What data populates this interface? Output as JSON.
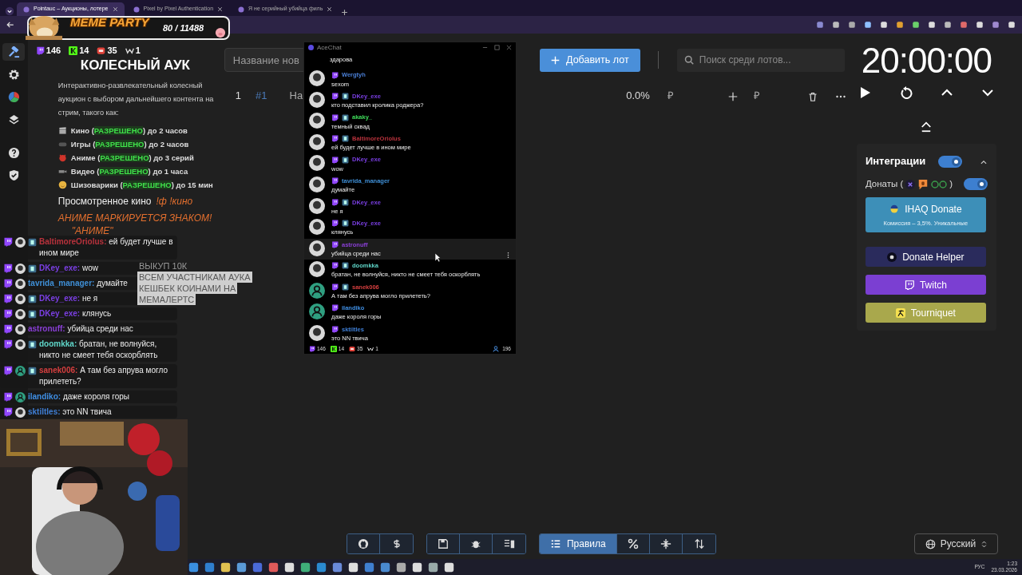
{
  "browser": {
    "tabs": [
      {
        "title": "Pointauc – Аукционы, лотере",
        "selected": true
      },
      {
        "title": "Pixel by Pixel Authentication",
        "selected": false
      },
      {
        "title": "Я не серийный убийца филь",
        "selected": false
      }
    ]
  },
  "meme_party": {
    "title": "MEME PARTY",
    "count": "80 / 11488"
  },
  "sidebar": {
    "items": [
      {
        "selected": true
      },
      {
        "selected": false
      },
      {
        "selected": false
      },
      {
        "selected": false
      },
      {
        "selected": false
      },
      {
        "selected": false
      }
    ]
  },
  "stats": [
    {
      "kind": "twitch",
      "value": "146"
    },
    {
      "kind": "kick",
      "value": "14"
    },
    {
      "kind": "live",
      "value": "35"
    },
    {
      "kind": "w",
      "value": "1"
    }
  ],
  "info": {
    "title": "КОЛЕСНЫЙ АУК",
    "description": "Интерактивно-развлекательный колесный аукцион с выбором дальнейшего контента на стрим, такого как:",
    "categories": [
      {
        "kind": "movie",
        "label": "Кино (",
        "status": "РАЗРЕШЕНО",
        "suffix": ") до 2 часов"
      },
      {
        "kind": "game",
        "label": "Игры (",
        "status": "РАЗРЕШЕНО",
        "suffix": ") до 2 часов"
      },
      {
        "kind": "anime",
        "label": "Аниме (",
        "status": "РАЗРЕШЕНО",
        "suffix": ") до 3 серий"
      },
      {
        "kind": "video",
        "label": "Видео (",
        "status": "РАЗРЕШЕНО",
        "suffix": ") до 1 часа"
      },
      {
        "kind": "meme",
        "label": "Шизоварики (",
        "status": "РАЗРЕШЕНО",
        "suffix": ") до 15 мин"
      }
    ],
    "watched": {
      "label": "Просмотренное кино",
      "commands": "!ф !кино"
    },
    "notes": [
      "АНИМЕ МАРКИРУЕТСЯ ЗНАКОМ!",
      "\"АНИМЕ\""
    ]
  },
  "side_chat": [
    {
      "user": "BaltimoreOriolus:",
      "color": "#b8323c",
      "text": "ей будет лучше в ином мире",
      "badge": true
    },
    {
      "user": "DKey_exe:",
      "color": "#7b3fe4",
      "text": "wow",
      "badge": true
    },
    {
      "user": "tavrida_manager:",
      "color": "#3f8fd6",
      "text": "думайте",
      "badge": false
    },
    {
      "user": "DKey_exe:",
      "color": "#7b3fe4",
      "text": "не я",
      "badge": true
    },
    {
      "user": "DKey_exe:",
      "color": "#7b3fe4",
      "text": "клянусь",
      "badge": true
    },
    {
      "user": "astronuff:",
      "color": "#8a3fd6",
      "text": "убийца среди нас",
      "badge": false
    },
    {
      "user": "doomkka:",
      "color": "#5fd6c9",
      "text": "братан, не волнуйся, никто не смеет тебя оскорблять",
      "badge": true
    },
    {
      "user": "sanek006:",
      "color": "#d63f3f",
      "text": "А там без апрува могло прилететь?",
      "kind": "person",
      "badge": true
    },
    {
      "user": "ilandiko:",
      "color": "#3f8fe4",
      "text": "даже короля горы",
      "kind": "person",
      "badge": false
    },
    {
      "user": "sktiltles:",
      "color": "#3f7fd6",
      "text": "это NN твича",
      "badge": false
    }
  ],
  "announcement": [
    "ВЫКУП 10К",
    "ВСЕМ УЧАСТНИКАМ АУКА",
    "КЕШБЕК КОИНАМИ НА",
    "МЕМАЛЕРТС"
  ],
  "lot_form": {
    "placeholder": "Название нов",
    "button": "Добавить лот",
    "search_placeholder": "Поиск среди лотов..."
  },
  "lots": [
    {
      "index": "1",
      "id": "#1",
      "name": "На",
      "percent": "0.0%",
      "currency": "₽",
      "amount_currency": "₽"
    }
  ],
  "timer": "20:00:00",
  "integrations": {
    "title": "Интеграции",
    "on": true,
    "expanded": true,
    "donations": {
      "label": "Донаты (",
      "suffix": ")",
      "on": true
    },
    "services": [
      {
        "kind": "ihaq",
        "name": "IHAQ Donate",
        "note": "Комиссия – 3,5%. Уникальные",
        "color": "#3d8fb8"
      },
      {
        "kind": "helper",
        "name": "Donate Helper",
        "color": "#2a2b5c"
      },
      {
        "kind": "twitch",
        "name": "Twitch",
        "color": "#7b3fd2"
      },
      {
        "kind": "tourniquet",
        "name": "Tourniquet",
        "color": "#a9a84c"
      }
    ]
  },
  "toolbar": {
    "rules": "Правила"
  },
  "language": "Русский",
  "acechat": {
    "title": "AceChat",
    "messages": [
      {
        "kind": "continuation",
        "text": "здарова",
        "hovered": false
      },
      {
        "user": "Wergtyh",
        "color": "#4a7fd6",
        "text": "sexom",
        "badge": false,
        "hovered": false
      },
      {
        "user": "DKey_exe",
        "color": "#7b3fe4",
        "text": "кто подставил кролика роджера?",
        "badge": true,
        "hovered": false
      },
      {
        "user": "akaky_",
        "color": "#3fdc5a",
        "text": "темный сквад",
        "badge": true,
        "hovered": false
      },
      {
        "user": "BaltimoreOriolus",
        "color": "#b8323c",
        "text": "ей будет лучше в ином мире",
        "badge": true,
        "hovered": false
      },
      {
        "user": "DKey_exe",
        "color": "#7b3fe4",
        "text": "wow",
        "badge": true,
        "hovered": false
      },
      {
        "user": "tavrida_manager",
        "color": "#3f8fd6",
        "text": "думайте",
        "badge": false,
        "hovered": false
      },
      {
        "user": "DKey_exe",
        "color": "#7b3fe4",
        "text": "не я",
        "badge": true,
        "hovered": false
      },
      {
        "user": "DKey_exe",
        "color": "#7b3fe4",
        "text": "клянусь",
        "badge": true,
        "hovered": false
      },
      {
        "user": "astronuff",
        "color": "#8a3fd6",
        "text": "убийца среди нас",
        "badge": false,
        "hovered": true
      },
      {
        "user": "doomkka",
        "color": "#5fd6c9",
        "text": "братан, не волнуйся, никто не смеет тебя оскорблять",
        "badge": true,
        "hovered": false
      },
      {
        "kind": "person",
        "user": "sanek006",
        "color": "#d63f3f",
        "text": "А там без апрува могло прилететь?",
        "badge": true,
        "hovered": false
      },
      {
        "kind": "person",
        "user": "ilandiko",
        "color": "#3f8fe4",
        "text": "даже короля горы",
        "badge": false,
        "hovered": false
      },
      {
        "user": "sktiltles",
        "color": "#3f7fd6",
        "text": "это NN твича",
        "badge": false,
        "hovered": false
      }
    ],
    "stats": [
      {
        "kind": "twitch",
        "value": "146"
      },
      {
        "kind": "kick",
        "value": "14"
      },
      {
        "kind": "live",
        "value": "35"
      },
      {
        "kind": "w",
        "value": "1"
      }
    ],
    "viewers": "196"
  },
  "taskbar": {
    "language": "РУС",
    "time": "1:23",
    "date": "23.03.2026"
  }
}
